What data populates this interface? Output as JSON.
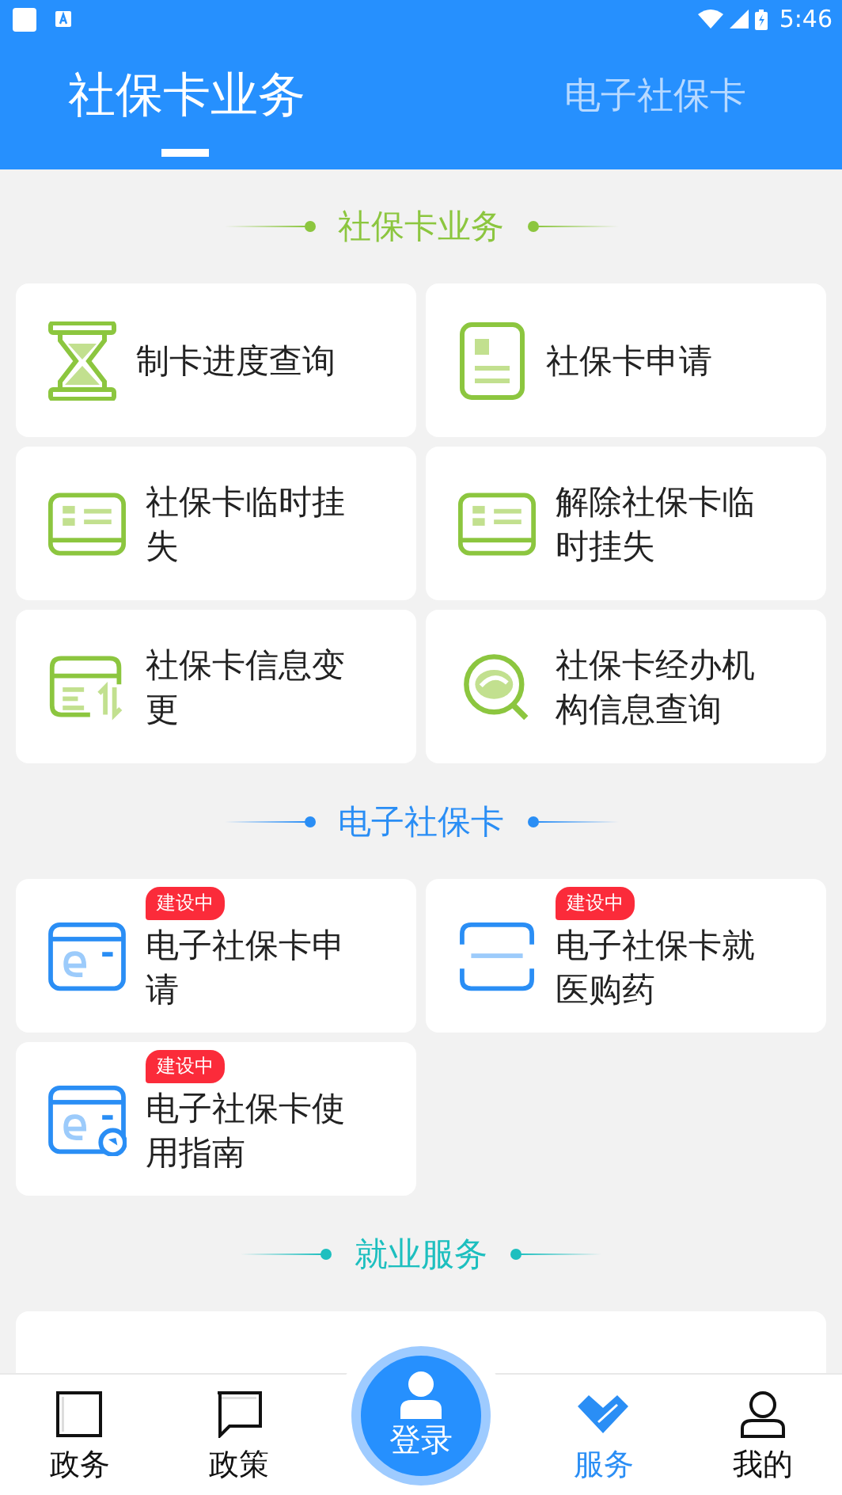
{
  "status_bar": {
    "time": "5:46"
  },
  "tabs": [
    {
      "label": "社保卡业务",
      "selected": true
    },
    {
      "label": "电子社保卡",
      "selected": false
    }
  ],
  "sections": [
    {
      "title": "社保卡业务",
      "color": "#8cc63f",
      "items": [
        {
          "label": "制卡进度查询",
          "kind": "hourglass"
        },
        {
          "label": "社保卡申请",
          "kind": "document"
        },
        {
          "label": "社保卡临时挂失",
          "kind": "card"
        },
        {
          "label": "解除社保卡临时挂失",
          "kind": "card"
        },
        {
          "label": "社保卡信息变更",
          "kind": "exchange"
        },
        {
          "label": "社保卡经办机构信息查询",
          "kind": "search"
        }
      ]
    },
    {
      "title": "电子社保卡",
      "color": "#2a8ef5",
      "items": [
        {
          "label": "电子社保卡申请",
          "kind": "ecard",
          "badge": "建设中"
        },
        {
          "label": "电子社保卡就医购药",
          "kind": "scan",
          "badge": "建设中"
        },
        {
          "label": "电子社保卡使用指南",
          "kind": "guide",
          "badge": "建设中"
        }
      ]
    },
    {
      "title": "就业服务",
      "color": "#1dbfbf",
      "items": [
        {
          "kind": "blank"
        }
      ]
    }
  ],
  "bottom_nav": [
    {
      "label": "政务",
      "kind": "square",
      "selected": false
    },
    {
      "label": "政策",
      "kind": "chat",
      "selected": false
    },
    {
      "label": "登录",
      "kind": "login",
      "selected": false
    },
    {
      "label": "服务",
      "kind": "heart",
      "selected": true
    },
    {
      "label": "我的",
      "kind": "person",
      "selected": false
    }
  ]
}
